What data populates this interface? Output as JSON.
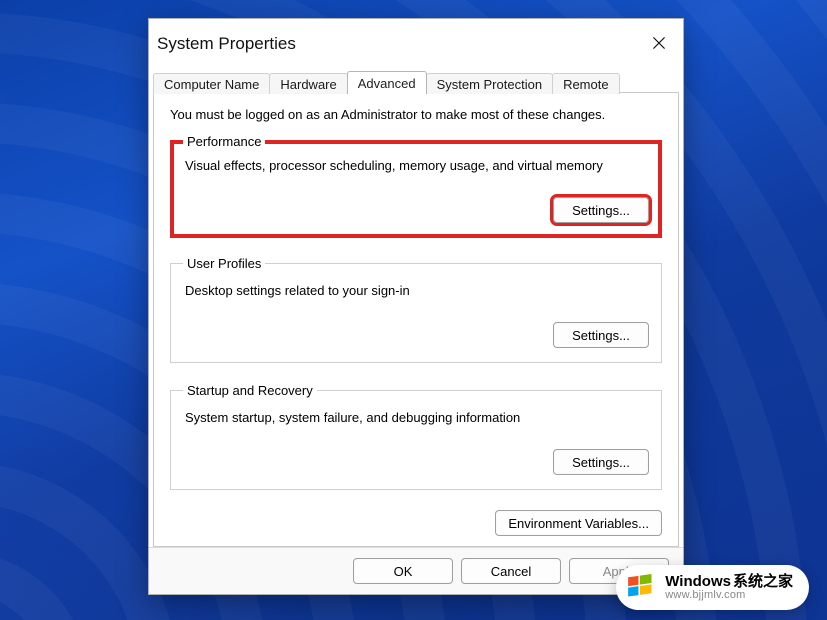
{
  "dialog": {
    "title": "System Properties",
    "tabs": {
      "computer_name": "Computer Name",
      "hardware": "Hardware",
      "advanced": "Advanced",
      "system_protection": "System Protection",
      "remote": "Remote"
    },
    "intro": "You must be logged on as an Administrator to make most of these changes.",
    "groups": {
      "performance": {
        "legend": "Performance",
        "desc": "Visual effects, processor scheduling, memory usage, and virtual memory",
        "button": "Settings..."
      },
      "user_profiles": {
        "legend": "User Profiles",
        "desc": "Desktop settings related to your sign-in",
        "button": "Settings..."
      },
      "startup_recovery": {
        "legend": "Startup and Recovery",
        "desc": "System startup, system failure, and debugging information",
        "button": "Settings..."
      }
    },
    "env_button": "Environment Variables...",
    "footer": {
      "ok": "OK",
      "cancel": "Cancel",
      "apply": "Apply"
    }
  },
  "watermark": {
    "brand_en": "Windows",
    "brand_cn": "系统之家",
    "url": "www.bjjmlv.com"
  }
}
